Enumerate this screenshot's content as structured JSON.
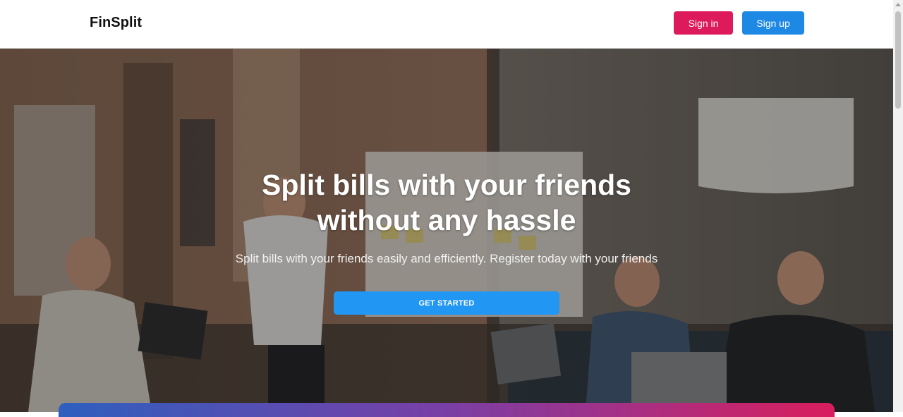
{
  "header": {
    "brand": "FinSplit",
    "signin_label": "Sign in",
    "signup_label": "Sign up"
  },
  "hero": {
    "title_line1": "Split bills with your friends",
    "title_line2": "without any hassle",
    "subtitle": "Split bills with your friends easily and efficiently. Register today with your friends",
    "cta_label": "GET STARTED"
  },
  "colors": {
    "signin": "#dc1a5c",
    "signup": "#1e88e5",
    "cta": "#2196f3"
  }
}
